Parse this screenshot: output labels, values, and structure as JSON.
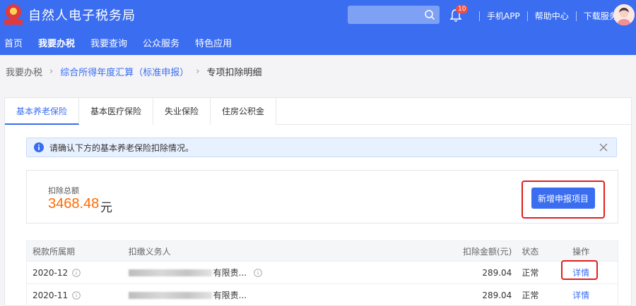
{
  "header": {
    "title": "自然人电子税务局",
    "search_placeholder": "",
    "notification_count": "10",
    "links": [
      "手机APP",
      "帮助中心",
      "下载服务"
    ]
  },
  "nav": [
    {
      "label": "首页",
      "active": false
    },
    {
      "label": "我要办税",
      "active": true
    },
    {
      "label": "我要查询",
      "active": false
    },
    {
      "label": "公众服务",
      "active": false
    },
    {
      "label": "特色应用",
      "active": false
    }
  ],
  "breadcrumb": {
    "root": "我要办税",
    "middle": "综合所得年度汇算（标准申报）",
    "current": "专项扣除明细"
  },
  "tabs": [
    {
      "label": "基本养老保险",
      "active": true
    },
    {
      "label": "基本医疗保险",
      "active": false
    },
    {
      "label": "失业保险",
      "active": false
    },
    {
      "label": "住房公积金",
      "active": false
    }
  ],
  "alert": {
    "message": "请确认下方的基本养老保险扣除情况。"
  },
  "summary": {
    "label": "扣除总额",
    "amount": "3468.48",
    "unit": "元",
    "add_button": "新增申报项目"
  },
  "table": {
    "headers": {
      "period": "税款所属期",
      "agent": "扣缴义务人",
      "amount": "扣除金额(元)",
      "status": "状态",
      "operation": "操作"
    },
    "rows": [
      {
        "period": "2020-12",
        "agent_suffix": "有限责...",
        "amount": "289.04",
        "status": "正常",
        "action": "详情"
      },
      {
        "period": "2020-11",
        "agent_suffix": "有限责...",
        "amount": "289.04",
        "status": "正常",
        "action": "详情"
      }
    ]
  },
  "colors": {
    "brand": "#3a6df0",
    "amount": "#ff6a00",
    "highlight": "#e01f1f"
  }
}
